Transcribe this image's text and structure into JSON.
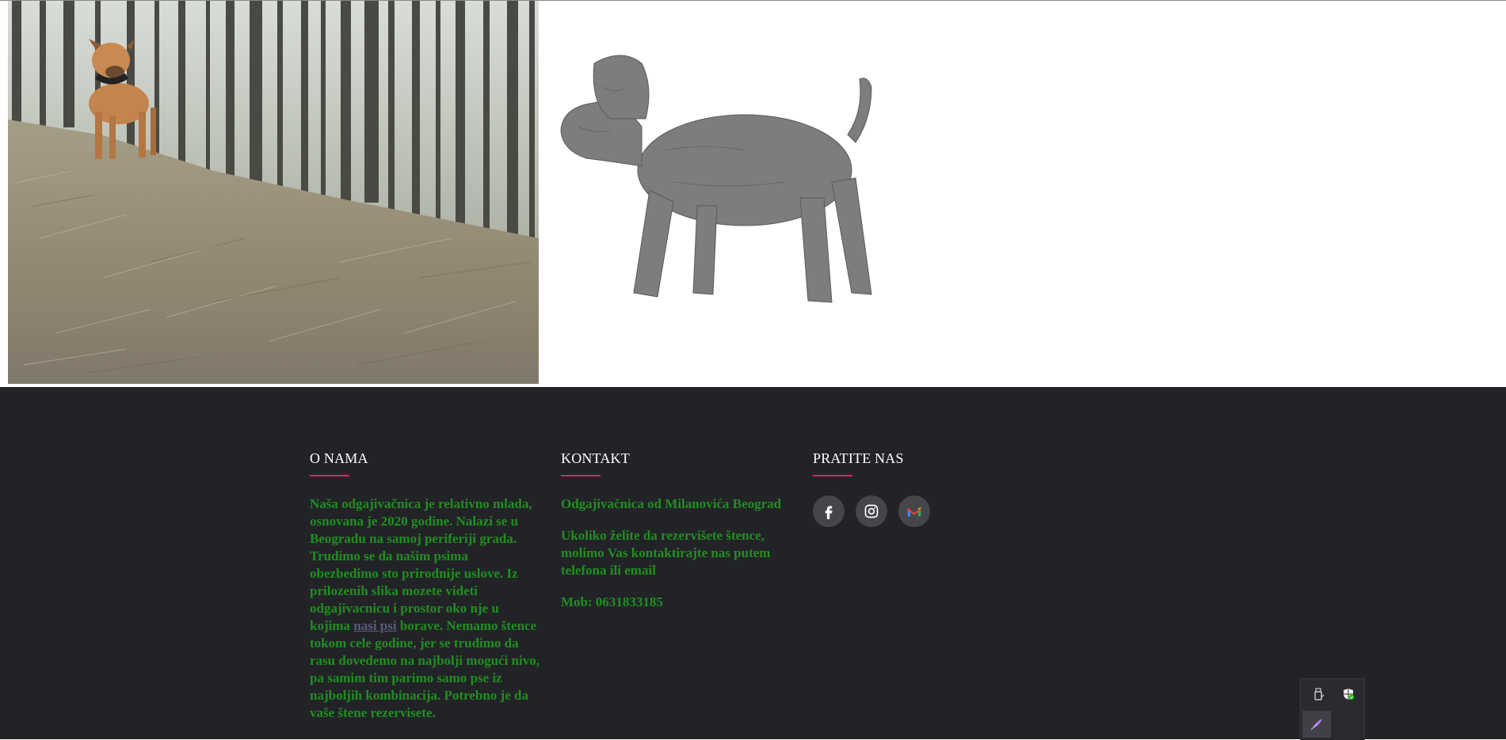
{
  "gallery": {
    "forest_photo_alt": "dog-in-pine-forest",
    "sketch_photo_alt": "cane-corso-pencil-sketch"
  },
  "footer": {
    "about": {
      "title": "O NAMA",
      "text_before_link": "Naša odgajivačnica je relativno mlada, osnovana je 2020 godine. Nalazi se u Beogradu na samoj periferiji grada. Trudimo se da našim psima obezbedimo sto prirodnije uslove. Iz prilozenih slika mozete videti odgajivacnicu i prostor oko nje u kojima ",
      "link_text": "nasi psi",
      "text_after_link": " borave. Nemamo štence tokom cele godine, jer se trudimo da rasu dovedemo na najbolji mogući nivo, pa samim tim parimo samo pse iz najboljih kombinacija. Potrebno je da vaše štene rezervisete."
    },
    "contact": {
      "title": "KONTAKT",
      "name": "Odgajivačnica od Milanovića Beograd",
      "reservation": "Ukoliko želite da rezervišete štence, molimo Vas kontaktirajte nas putem telefona ili email",
      "phone": "Mob: 0631833185"
    },
    "follow": {
      "title": "PRATITE NAS",
      "icons": [
        "facebook-icon",
        "instagram-icon",
        "gmail-icon"
      ]
    }
  },
  "colors": {
    "footer_bg": "#222327",
    "accent_underline": "#e91e63",
    "footer_text": "#1f8f1f",
    "social_bg": "#45464b"
  }
}
